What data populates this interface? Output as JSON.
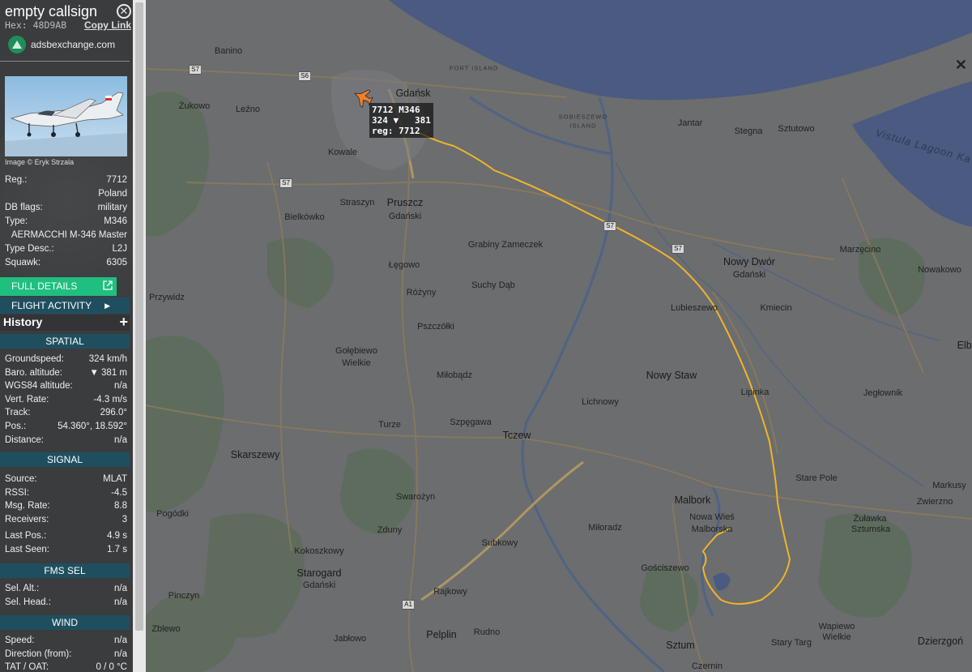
{
  "aircraft": {
    "callsign": "empty callsign",
    "hex": "Hex: 48D9AB",
    "copy_link": "Copy Link",
    "site": "adsbexchange.com",
    "photo_credit": "Image © Eryk Strzala"
  },
  "details": [
    {
      "key": "Reg.:",
      "value": "7712"
    },
    {
      "key": "",
      "value": "Poland"
    },
    {
      "key": "DB flags:",
      "value": "military"
    },
    {
      "key": "Type:",
      "value": "M346"
    },
    {
      "key": "",
      "value": "AERMACCHI M-346 Master"
    },
    {
      "key": "Type Desc.:",
      "value": "L2J"
    },
    {
      "key": "Squawk:",
      "value": "6305"
    }
  ],
  "buttons": {
    "full_details": "FULL DETAILS",
    "flight_activity": "FLIGHT ACTIVITY",
    "history": "History",
    "history_plus": "+"
  },
  "sections": {
    "spatial": "SPATIAL",
    "signal": "SIGNAL",
    "fms_sel": "FMS SEL",
    "wind": "WIND"
  },
  "spatial": [
    {
      "key": "Groundspeed:",
      "value": "324 km/h"
    },
    {
      "key": "Baro. altitude:",
      "value": "▼ 381 m"
    },
    {
      "key": "WGS84 altitude:",
      "value": "n/a"
    },
    {
      "key": "Vert. Rate:",
      "value": "-4.3 m/s"
    },
    {
      "key": "Track:",
      "value": "296.0°"
    },
    {
      "key": "Pos.:",
      "value": "54.360°, 18.592°"
    },
    {
      "key": "Distance:",
      "value": "n/a"
    }
  ],
  "signal": [
    {
      "key": "Source:",
      "value": "MLAT"
    },
    {
      "key": "RSSI:",
      "value": "-4.5"
    },
    {
      "key": "Msg. Rate:",
      "value": "8.8"
    },
    {
      "key": "Receivers:",
      "value": "3"
    },
    {
      "key": "Last Pos.:",
      "value": "4.9 s"
    },
    {
      "key": "Last Seen:",
      "value": "1.7 s"
    }
  ],
  "fms": [
    {
      "key": "Sel. Alt.:",
      "value": "n/a"
    },
    {
      "key": "Sel. Head.:",
      "value": "n/a"
    }
  ],
  "wind": [
    {
      "key": "Speed:",
      "value": "n/a"
    },
    {
      "key": "Direction (from):",
      "value": "n/a"
    },
    {
      "key": "TAT / OAT:",
      "value": "0 / 0 °C"
    }
  ],
  "map": {
    "info_label": [
      "7712 M346",
      "324 ▼   381",
      "reg: 7712"
    ],
    "water_label": "Vistula Lagoon Ka",
    "island_labels": [
      "PORT ISLAND",
      "SOBIESZEWO",
      "ISLAND"
    ],
    "road_shields": [
      "S6",
      "S7",
      "S7",
      "S7",
      "S7",
      "A1"
    ],
    "places": [
      "Banino",
      "Żukowo",
      "Leźno",
      "Kowale",
      "Gdańsk",
      "Jantar",
      "Stegna",
      "Sztutowo",
      "Straszyn",
      "Pruszcz",
      "Gdański",
      "Bielkówko",
      "Grabiny Zameczek",
      "Łęgowo",
      "Przywidz",
      "Suchy Dąb",
      "Różyny",
      "Nowy Dwór",
      "Gdański",
      "Marzęcino",
      "Nowakowo",
      "Lubieszewo",
      "Kmiecin",
      "Pszczółki",
      "Gołębiewo",
      "Wielkie",
      "Elbl",
      "Miłobądz",
      "Nowy Staw",
      "Lichnowy",
      "Lipinka",
      "Jegłownik",
      "Turze",
      "Szpęgawa",
      "Tczew",
      "Skarszewy",
      "Stare Pole",
      "Swarożyn",
      "Malbork",
      "Markusy",
      "Zwierzno",
      "Nowa Wieś",
      "Malborska",
      "Pogódki",
      "Żuławka",
      "Sztumska",
      "Miłoradz",
      "Zduny",
      "Subkowy",
      "Kokoszkowy",
      "Gościszewo",
      "Starogard",
      "Gdański",
      "Rajkowy",
      "Pinczyn",
      "Pelplin",
      "Rudno",
      "Jabłowo",
      "Zblewo",
      "Sztum",
      "Stary Targ",
      "Wapiewo",
      "Wielkie",
      "Dzierzgoń",
      "Czernin"
    ]
  },
  "colors": {
    "sidebar_bg": "#3a3c3e",
    "accent_green": "#1fbf7f",
    "section_header": "#1f4f5f",
    "track": "#f0b429",
    "aircraft": "#f07f2a"
  }
}
